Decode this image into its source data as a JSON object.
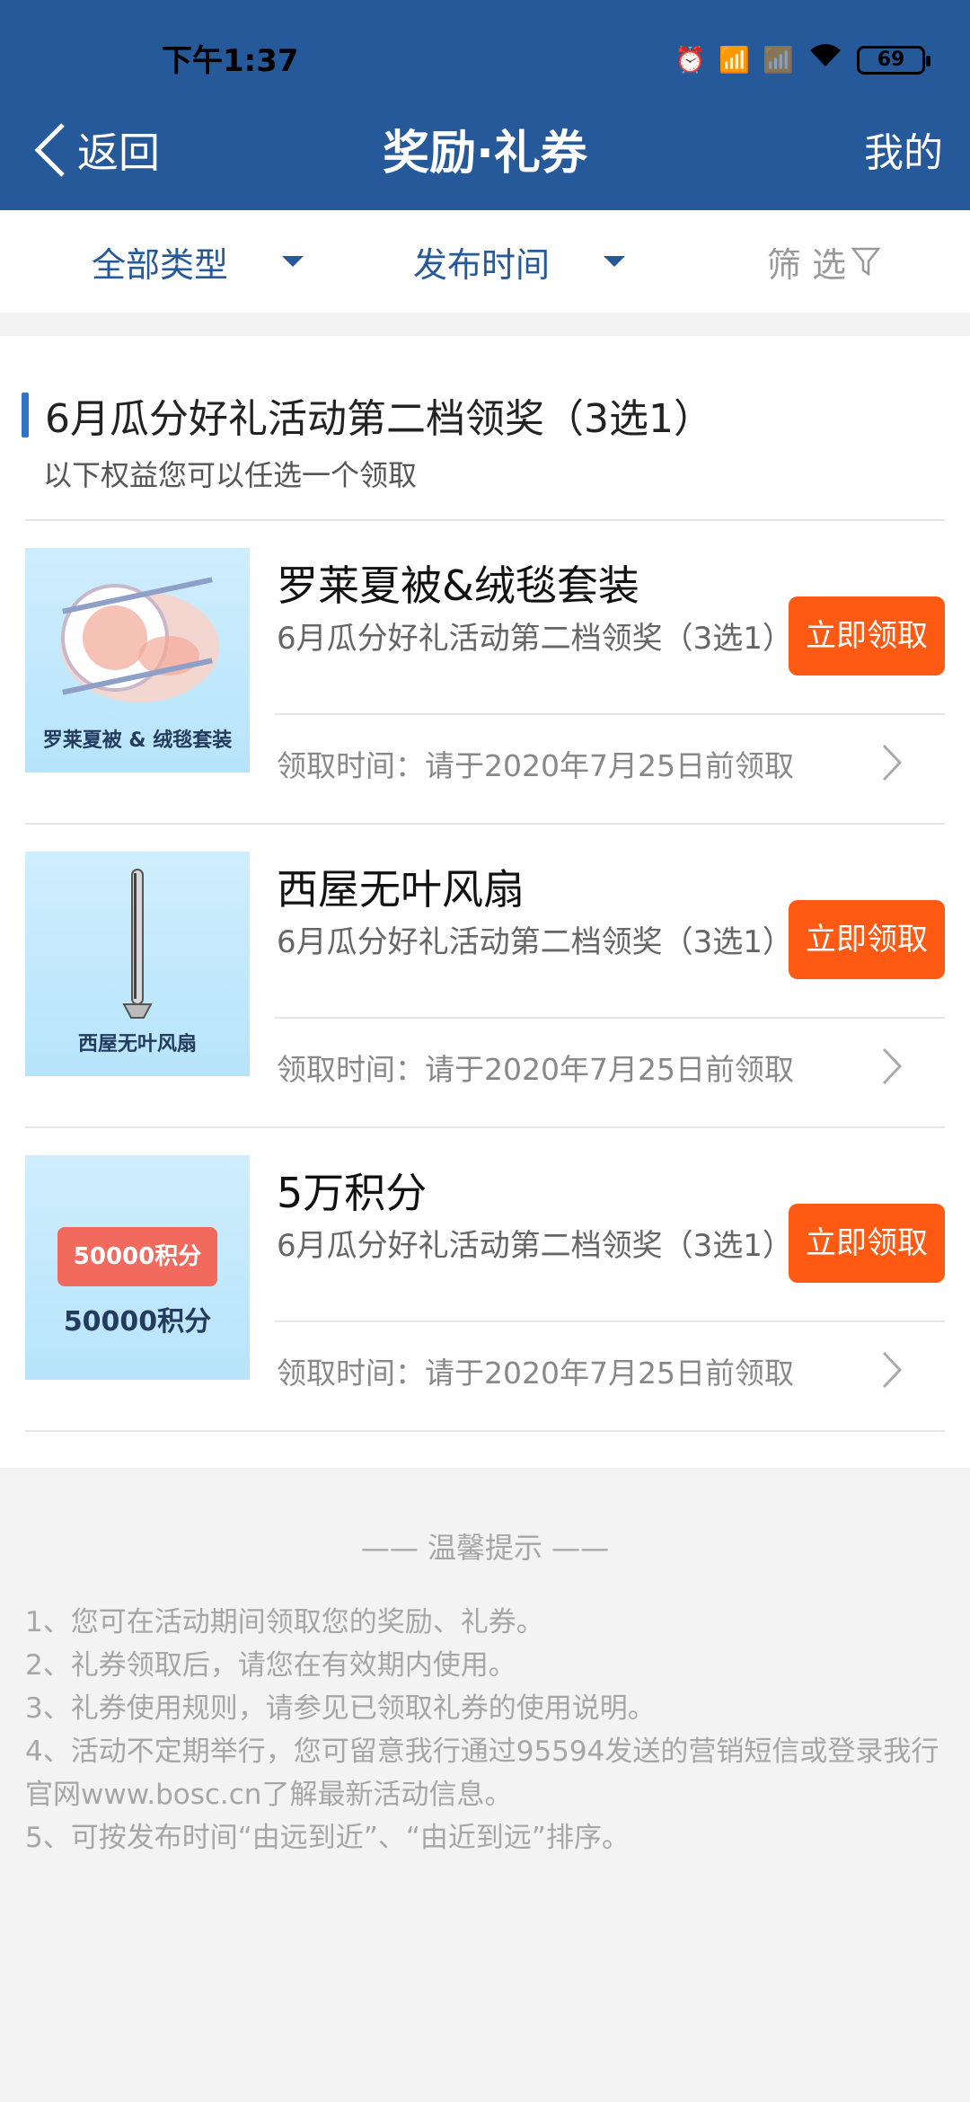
{
  "status_bar": {
    "time": "下午1:37",
    "battery": "69",
    "icons": [
      "alarm-icon",
      "hd-signal-icon",
      "signal-off-icon",
      "wifi-icon",
      "battery-icon"
    ]
  },
  "header": {
    "back_label": "返回",
    "title": "奖励·礼券",
    "right_label": "我的"
  },
  "filters": {
    "type_label": "全部类型",
    "time_label": "发布时间",
    "screen_label": "筛 选"
  },
  "section": {
    "title": "6月瓜分好礼活动第二档领奖（3选1）",
    "subtitle": "以下权益您可以任选一个领取"
  },
  "items": [
    {
      "title": "罗莱夏被&绒毯套装",
      "desc": "6月瓜分好礼活动第二档领奖（3选1）",
      "button": "立即领取",
      "time": "领取时间：请于2020年7月25日前领取",
      "thumb_caption": "罗莱夏被 & 绒毯套装"
    },
    {
      "title": "西屋无叶风扇",
      "desc": "6月瓜分好礼活动第二档领奖（3选1）",
      "button": "立即领取",
      "time": "领取时间：请于2020年7月25日前领取",
      "thumb_caption": "西屋无叶风扇"
    },
    {
      "title": "5万积分",
      "desc": "6月瓜分好礼活动第二档领奖（3选1）",
      "button": "立即领取",
      "time": "领取时间：请于2020年7月25日前领取",
      "thumb_caption": "50000积分",
      "thumb_badge": "50000积分"
    }
  ],
  "tips": {
    "title": "—— 温馨提示 ——",
    "lines": [
      "1、您可在活动期间领取您的奖励、礼券。",
      "2、礼券领取后，请您在有效期内使用。",
      "3、礼券使用规则，请参见已领取礼券的使用说明。",
      "4、活动不定期举行，您可留意我行通过95594发送的营销短信或登录我行官网www.bosc.cn了解最新活动信息。",
      "5、可按发布时间“由远到近”、“由近到远”排序。"
    ]
  },
  "colors": {
    "header_bg": "#26599a",
    "accent_blue": "#2f74c6",
    "claim_button": "#ff5a14",
    "page_bg": "#f3f3f3"
  }
}
